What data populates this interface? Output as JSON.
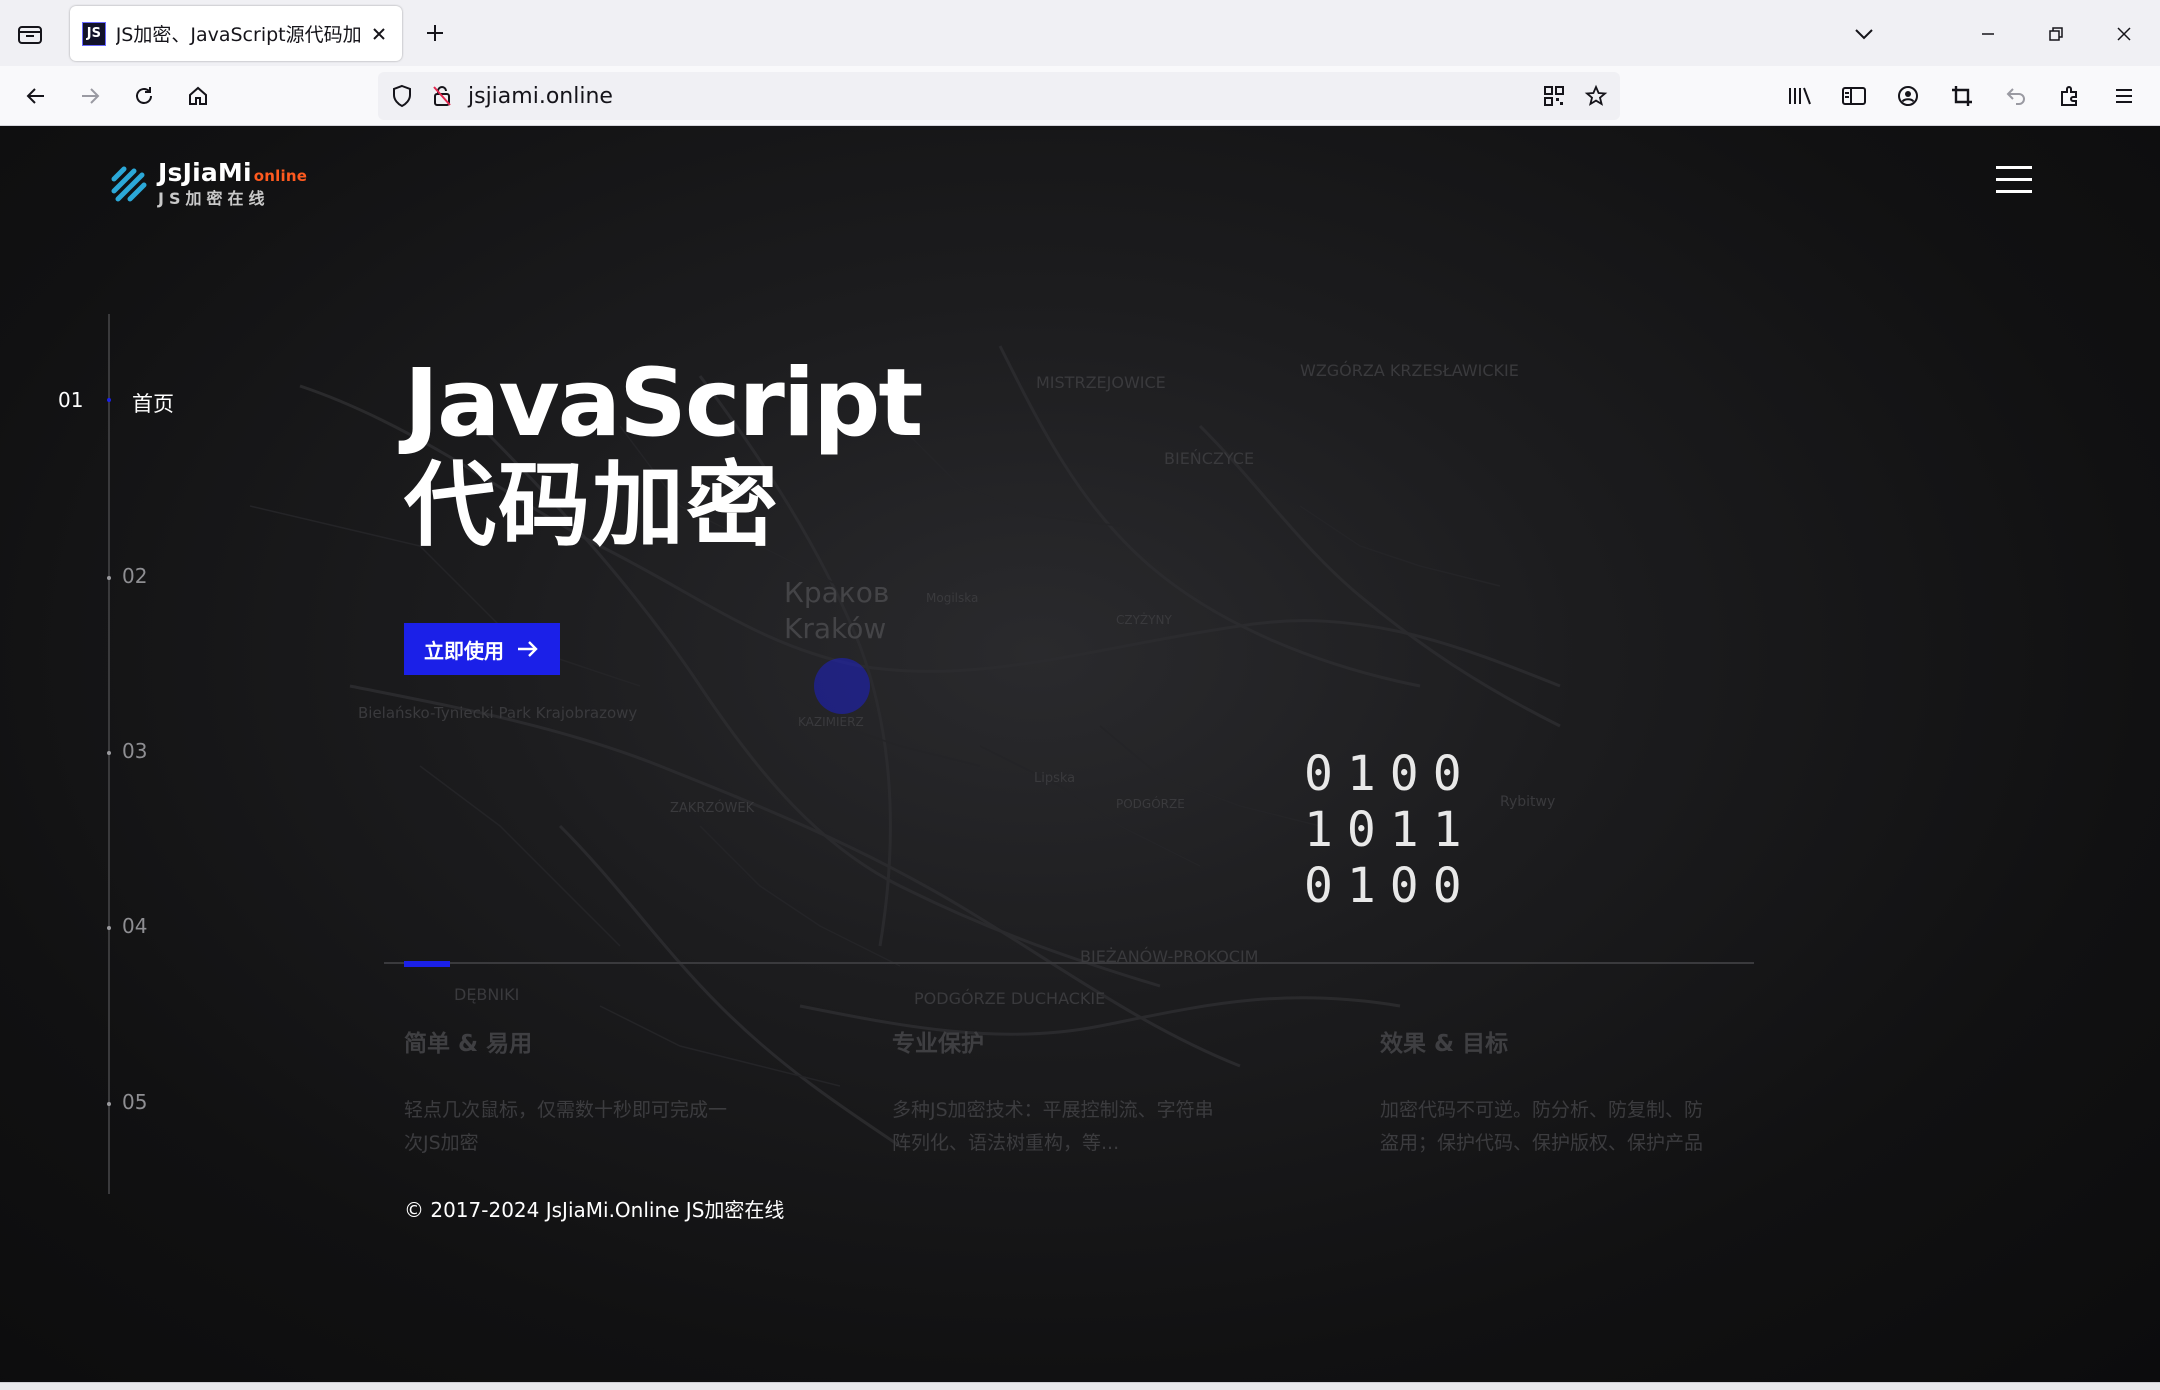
{
  "browser": {
    "tab_title": "JS加密、JavaScript源代码加密",
    "favicon_text": "JS",
    "url": "jsjiami.online"
  },
  "site": {
    "brand": "JsJiaMi",
    "brand_suffix": "online",
    "tagline": "JS加密在线",
    "accent_color": "#1b20e8",
    "brand_suffix_color": "#ff5a1f"
  },
  "rail": {
    "items": [
      {
        "number": "01",
        "label": "首页",
        "active": true
      },
      {
        "number": "02"
      },
      {
        "number": "03"
      },
      {
        "number": "04"
      },
      {
        "number": "05"
      }
    ]
  },
  "hero": {
    "title_line1": "JavaScript",
    "title_line2": "代码加密",
    "cta_label": "立即使用"
  },
  "binary": {
    "lines": [
      "0100",
      "1011",
      "0100"
    ]
  },
  "features": [
    {
      "title": "简单 & 易用",
      "desc_line1": "轻点几次鼠标，仅需数十秒即可完成一",
      "desc_line2": "次JS加密"
    },
    {
      "title": "专业保护",
      "desc_line1": "多种JS加密技术：平展控制流、字符串",
      "desc_line2": "阵列化、语法树重构，等..."
    },
    {
      "title": "效果 & 目标",
      "desc_line1": "加密代码不可逆。防分析、防复制、防",
      "desc_line2": "盗用；保护代码、保护版权、保护产品"
    }
  ],
  "map_labels": {
    "city_ru": "Краков",
    "city_pl": "Kraków",
    "districts": [
      "MISTRZEJOWICE",
      "WZGÓRZA KRZESŁAWICKIE",
      "BIEŃCZYCE",
      "CZYŻYNY",
      "PODGÓRZE",
      "BIEŻANÓW-PROKOCIM",
      "PODGÓRZE DUCHACKIE",
      "DĘBNIKI",
      "ZAKRZÓWEK",
      "KAZIMIERZ",
      "Bielańsko-Tyniecki Park Krajobrazowy",
      "Mogilska",
      "Lipska",
      "Rybitwy"
    ]
  },
  "footer": {
    "copyright": "© 2017-2024 JsJiaMi.Online JS加密在线"
  }
}
